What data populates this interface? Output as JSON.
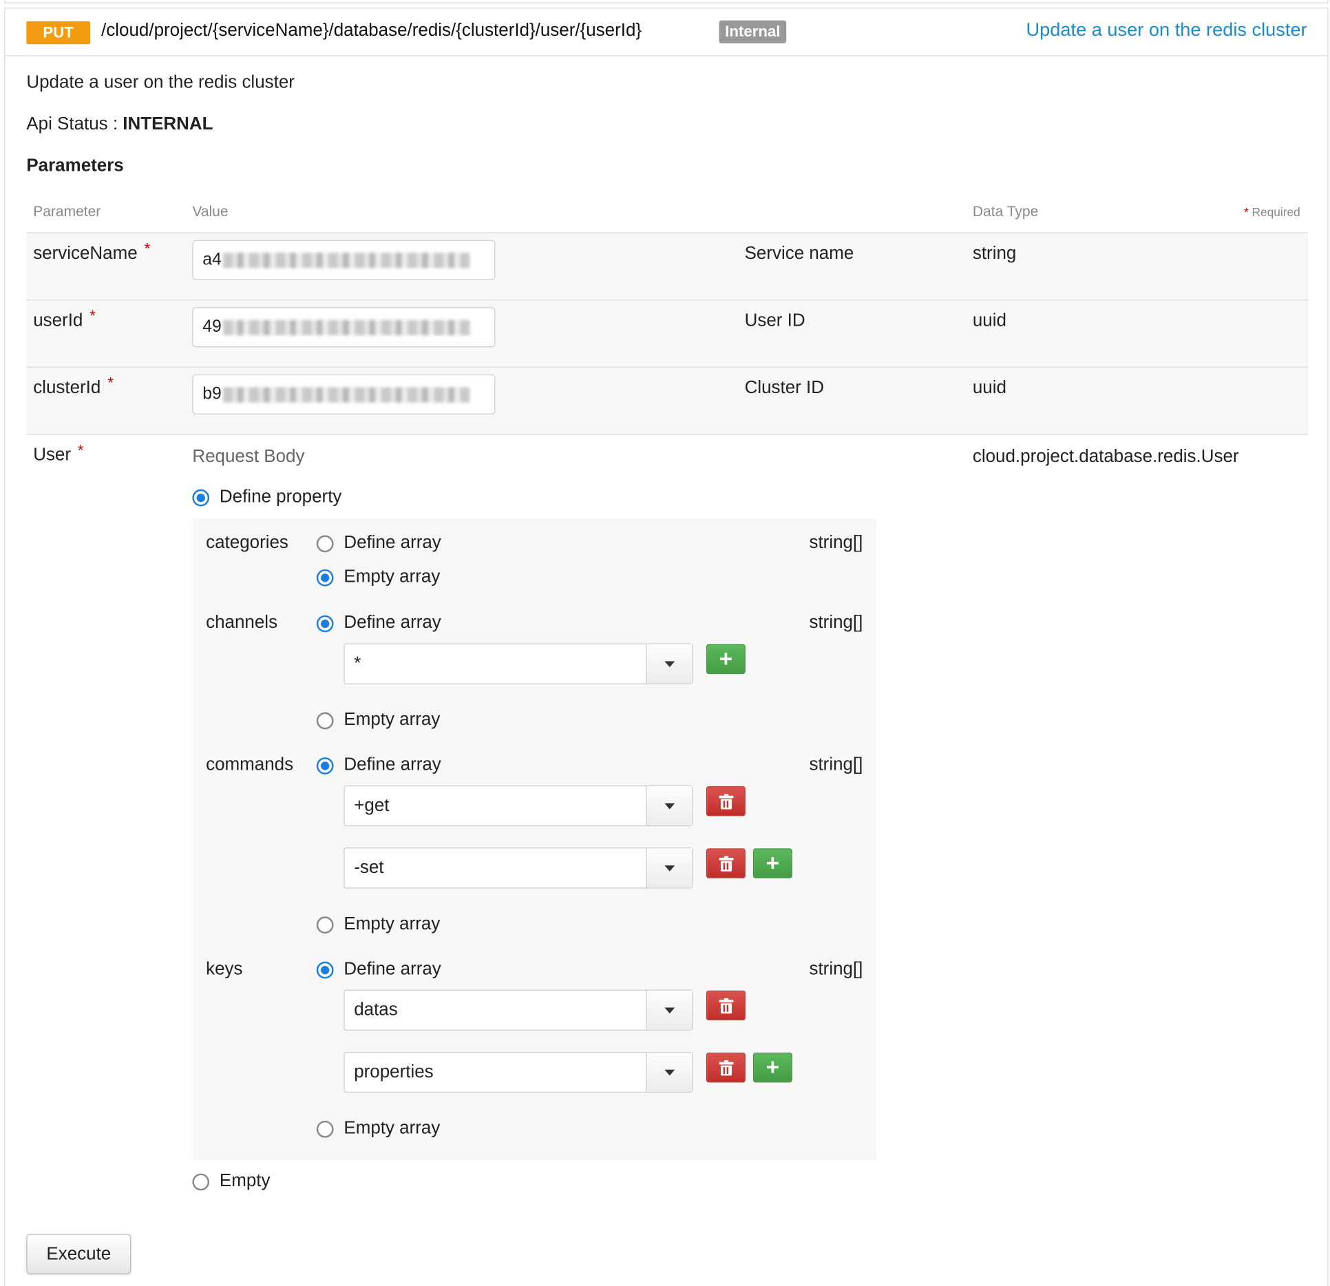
{
  "endpoint": {
    "method": "PUT",
    "path": "/cloud/project/{serviceName}/database/redis/{clusterId}/user/{userId}",
    "badge": "Internal",
    "summary": "Update a user on the redis cluster"
  },
  "description": "Update a user on the redis cluster",
  "api_status": {
    "label": "Api Status : ",
    "value": "INTERNAL"
  },
  "parameters_heading": "Parameters",
  "table_headers": {
    "parameter": "Parameter",
    "value": "Value",
    "data_type": "Data Type",
    "required_star": "*",
    "required": "Required"
  },
  "params": [
    {
      "name": "serviceName",
      "value_prefix": "a4",
      "description": "Service name",
      "type": "string"
    },
    {
      "name": "userId",
      "value_prefix": "49",
      "description": "User ID",
      "type": "uuid"
    },
    {
      "name": "clusterId",
      "value_prefix": "b9",
      "description": "Cluster ID",
      "type": "uuid"
    }
  ],
  "required_mark": "*",
  "body_param": {
    "name": "User",
    "value_label": "Request Body",
    "type": "cloud.project.database.redis.User",
    "define_property": "Define property",
    "empty": "Empty",
    "properties": [
      {
        "name": "categories",
        "type": "string[]",
        "define": "Define array",
        "empty": "Empty array",
        "selected": "empty",
        "items": []
      },
      {
        "name": "channels",
        "type": "string[]",
        "define": "Define array",
        "empty": "Empty array",
        "selected": "define",
        "items": [
          "*"
        ]
      },
      {
        "name": "commands",
        "type": "string[]",
        "define": "Define array",
        "empty": "Empty array",
        "selected": "define",
        "items": [
          "+get",
          "-set"
        ]
      },
      {
        "name": "keys",
        "type": "string[]",
        "define": "Define array",
        "empty": "Empty array",
        "selected": "define",
        "items": [
          "datas",
          "properties"
        ]
      }
    ]
  },
  "add_symbol": "+",
  "execute_label": "Execute",
  "colors": {
    "method_badge": "#f39c12",
    "internal_badge": "#999999",
    "link": "#1a8ccf",
    "add_button": "#5cb85c",
    "delete_button": "#d9534f",
    "radio_selected": "#1a7fe0"
  }
}
